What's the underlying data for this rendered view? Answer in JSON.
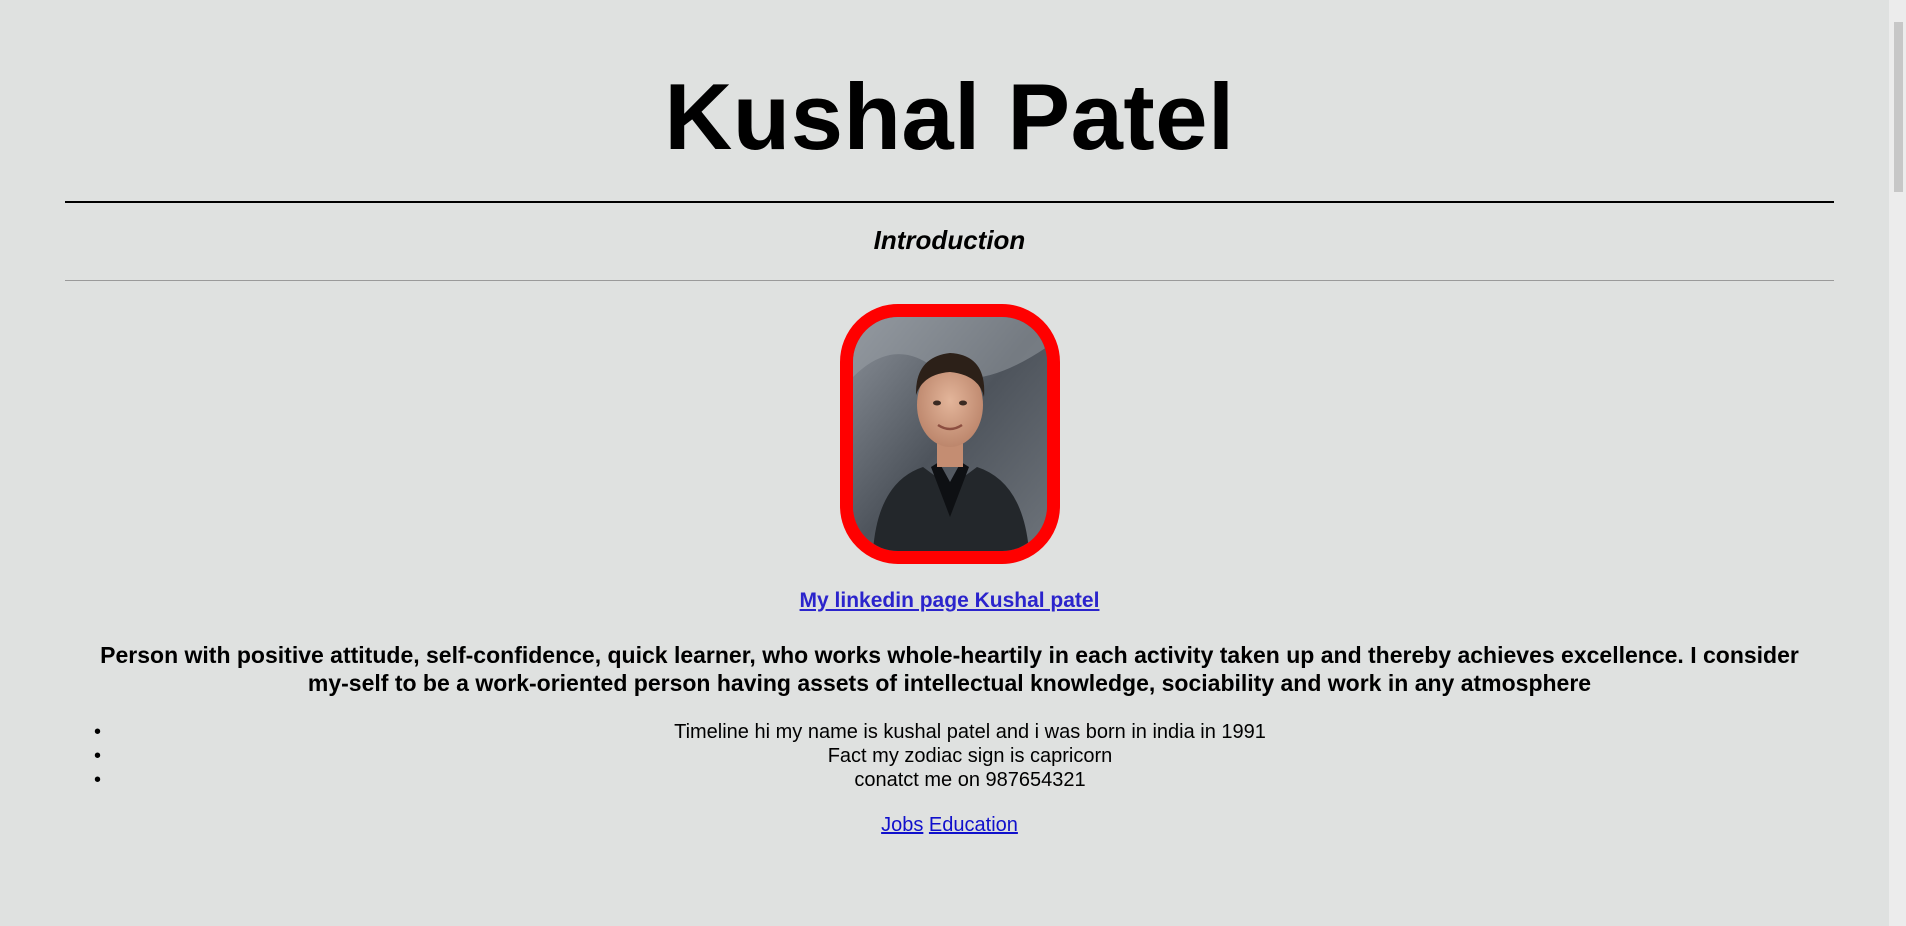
{
  "header": {
    "title": "Kushal Patel",
    "section_heading": "Introduction"
  },
  "profile": {
    "photo_alt": "Kushal Patel profile photo",
    "linkedin_label": "My linkedin page Kushal patel",
    "border_color": "#ff0000"
  },
  "about": {
    "text": "Person with positive attitude, self-confidence, quick learner, who works whole-heartily in each activity taken up and thereby achieves excellence. I consider my-self to be a work-oriented person having assets of intellectual knowledge, sociability and work in any atmosphere"
  },
  "facts": [
    {
      "text": "Timeline hi my name is kushal patel and i was born in india in 1991"
    },
    {
      "text": "Fact my zodiac sign is capricorn"
    },
    {
      "text": "conatct me on 987654321"
    }
  ],
  "nav": {
    "jobs_label": "Jobs",
    "education_label": "Education"
  },
  "colors": {
    "background": "#dfe1e0",
    "link": "#2b24cc"
  }
}
